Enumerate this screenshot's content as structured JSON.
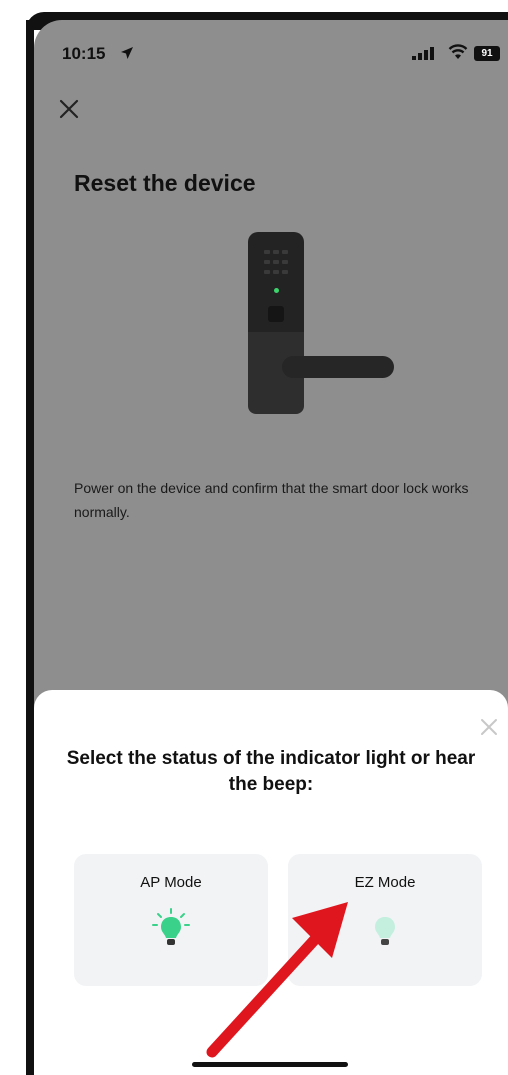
{
  "status_bar": {
    "time": "10:15",
    "battery": "91"
  },
  "header": {
    "title": "Reset the device"
  },
  "description": "Power on the device and confirm that the smart door lock works normally.",
  "sheet": {
    "title": "Select the status of the indicator light or hear the beep:",
    "options": [
      {
        "label": "AP Mode",
        "bulb": "flashing-bulb-icon"
      },
      {
        "label": "EZ Mode",
        "bulb": "dim-bulb-icon"
      }
    ]
  },
  "colors": {
    "overlay": "#8e8e8e",
    "bulb_bright": "#3ad28a",
    "bulb_dim": "#bfeedd",
    "annotation_arrow": "#e0161e"
  }
}
